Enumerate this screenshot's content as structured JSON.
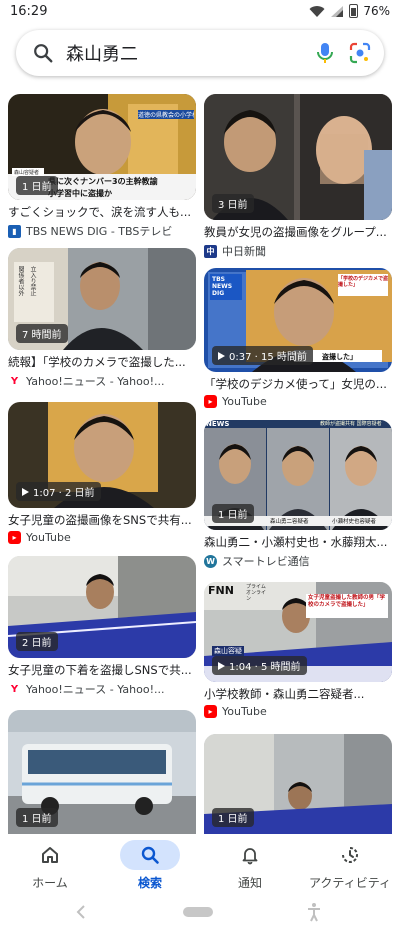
{
  "status": {
    "time": "16:29",
    "battery": "76%"
  },
  "search": {
    "query": "森山勇二"
  },
  "results": {
    "left": [
      {
        "title": "すごくショックで、涙を流す人も...",
        "source": "TBS NEWS DIG - TBSテレビ",
        "badge": "1 日前",
        "caption1": "道徳の県教会の小学校 教員盗撮事件",
        "caption2": "県に次ぐナンバー3の主幹教諭",
        "caption3": "小学習中に盗撮か",
        "chip": "森山容疑者"
      },
      {
        "title": "続報】「学校のカメラで盗撮した...",
        "source": "Yahoo!ニュース - Yahoo!...",
        "badge": "7 時間前",
        "sign1": "関係者以外",
        "sign2": "立入り禁止"
      },
      {
        "title": "女子児童の盗撮画像をSNSで共有...",
        "source": "YouTube",
        "badge": "1:07 · 2 日前"
      },
      {
        "title": "女子児童の下着を盗撮しSNSで共...",
        "source": "Yahoo!ニュース - Yahoo!...",
        "badge": "2 日前"
      },
      {
        "title": "",
        "source": "",
        "badge": "1 日前"
      }
    ],
    "right": [
      {
        "title": "教員が女児の盗撮画像をグループ...",
        "source": "中日新聞",
        "badge": "3 日前"
      },
      {
        "title": "「学校のデジカメ使って」女児の...",
        "source": "YouTube",
        "badge": "0:37 · 15 時間前",
        "logo": "TBS NEWS DIG",
        "quote": "「学校のデジカメで盗撮した」",
        "sub": "盗撮した」"
      },
      {
        "title": "森山勇二・小瀬村史也・水藤翔太...",
        "source": "スマートレビ通信",
        "badge": "1 日前",
        "header": "教師が盗撮共有 国際容疑者",
        "names": [
          "森山勇二容疑者",
          "小瀬村史也容疑者"
        ]
      },
      {
        "title": "小学校教師・森山勇二容疑者...",
        "source": "YouTube",
        "badge": "1:04 · 5 時間前",
        "logo": "FNN",
        "logo_sub": "プライム オンライン",
        "quote": "女子児童盗撮した教師の男「学校のカメラで盗撮した」",
        "chip": "森山容疑"
      },
      {
        "title": "",
        "source": "",
        "badge": "1 日前"
      }
    ]
  },
  "nav": {
    "items": [
      {
        "label": "ホーム"
      },
      {
        "label": "検索"
      },
      {
        "label": "通知"
      },
      {
        "label": "アクティビティ"
      }
    ]
  },
  "colors": {
    "accent": "#0b57d0",
    "youtube": "#ff0000",
    "yahoo": "#ff0033",
    "active_pill": "#d3e3fd"
  }
}
